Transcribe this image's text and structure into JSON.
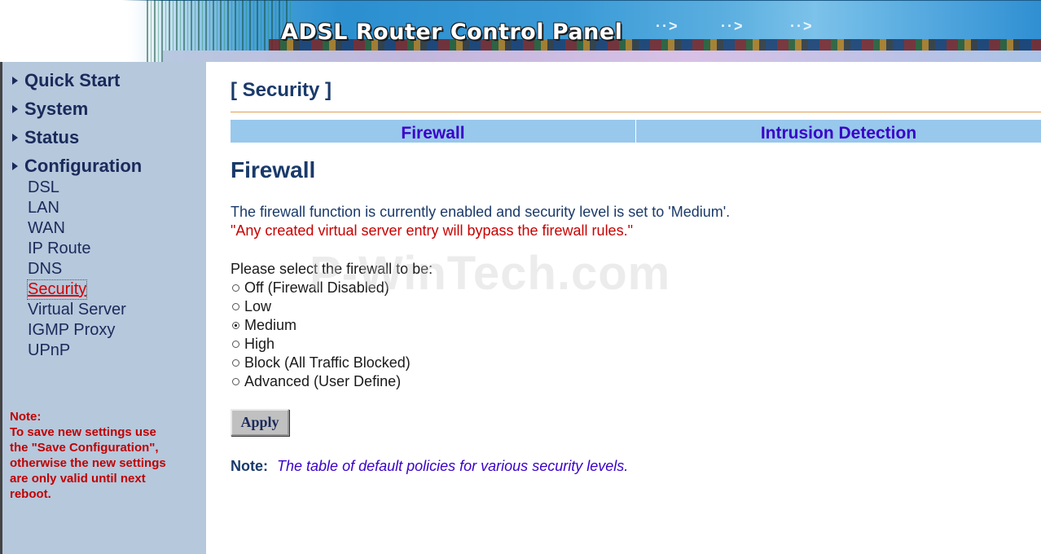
{
  "banner": {
    "title": "ADSL Router Control Panel",
    "arrows": "··>",
    "arrows2": "··>",
    "arrows3": "··>"
  },
  "sidebar": {
    "menu": [
      {
        "label": "Quick Start"
      },
      {
        "label": "System"
      },
      {
        "label": "Status"
      },
      {
        "label": "Configuration"
      }
    ],
    "submenu": [
      {
        "label": "DSL"
      },
      {
        "label": "LAN"
      },
      {
        "label": "WAN"
      },
      {
        "label": "IP Route"
      },
      {
        "label": "DNS"
      },
      {
        "label": "Security",
        "active": true
      },
      {
        "label": "Virtual Server"
      },
      {
        "label": "IGMP Proxy"
      },
      {
        "label": "UPnP"
      }
    ],
    "note": {
      "heading": "Note:",
      "lines": [
        "To save new settings use",
        "the \"Save Configuration\",",
        "otherwise the new settings",
        "are only valid until next",
        "reboot."
      ]
    }
  },
  "main": {
    "page_title": "[ Security ]",
    "tabs": [
      {
        "label": "Firewall"
      },
      {
        "label": "Intrusion Detection"
      }
    ],
    "section_title": "Firewall",
    "status_line": "The firewall function is currently enabled and security level is set to 'Medium'.",
    "warning_line": "\"Any created virtual server entry will bypass the firewall rules.\"",
    "select_label": "Please select the firewall to be:",
    "options": [
      {
        "label": "Off (Firewall Disabled)",
        "checked": false
      },
      {
        "label": "Low",
        "checked": false
      },
      {
        "label": "Medium",
        "checked": true
      },
      {
        "label": "High",
        "checked": false
      },
      {
        "label": "Block (All Traffic Blocked)",
        "checked": false
      },
      {
        "label": "Advanced (User Define)",
        "checked": false
      }
    ],
    "apply_label": "Apply",
    "bottom_note": {
      "label": "Note:",
      "link_text": "The table of default policies for various security levels."
    }
  },
  "watermark": "P-WinTech.com",
  "colors": {
    "sidebar_bg": "#b6c8dc",
    "tab_bg": "#98c8ec",
    "tab_text": "#3a00c8",
    "warning": "#c80000",
    "heading": "#1a3a6a"
  }
}
